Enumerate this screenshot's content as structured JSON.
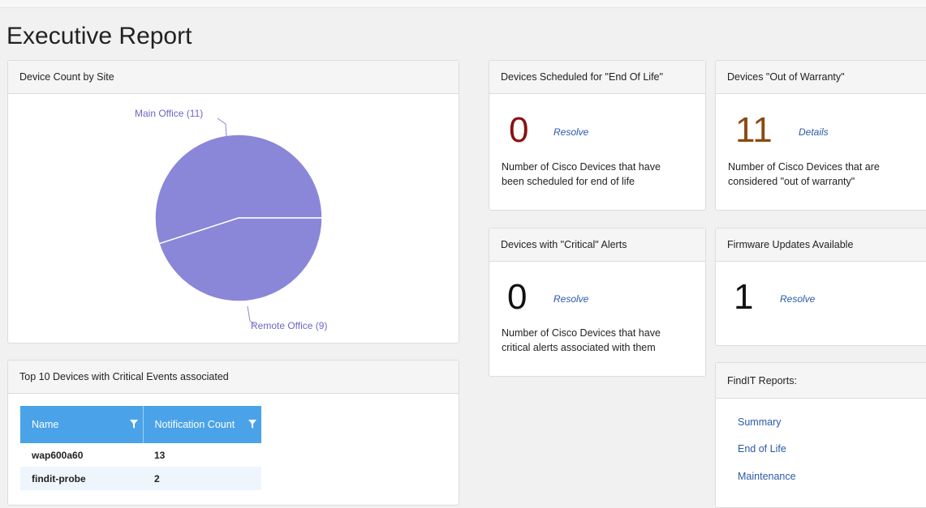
{
  "page_title": "Executive Report",
  "device_count": {
    "title": "Device Count by Site",
    "chart_data": {
      "type": "pie",
      "labels": [
        "Main Office (11)",
        "Remote Office (9)"
      ],
      "values": [
        11,
        9
      ],
      "colors": [
        "#8a86d8",
        "#8a86d8"
      ]
    }
  },
  "eol": {
    "title": "Devices Scheduled for \"End Of Life\"",
    "count": "0",
    "link": "Resolve",
    "description_line1": "Number of Cisco Devices that have",
    "description_line2": "been scheduled for end of life",
    "count_color": "#8b1010"
  },
  "warranty": {
    "title": "Devices \"Out of Warranty\"",
    "count": "11",
    "link": "Details",
    "description_line1": "Number of Cisco Devices that are",
    "description_line2": "considered \"out of warranty\"",
    "count_color": "#8a4b10"
  },
  "critical": {
    "title": "Devices with \"Critical\" Alerts",
    "count": "0",
    "link": "Resolve",
    "description_line1": "Number of Cisco Devices that have",
    "description_line2": "critical alerts associated with them"
  },
  "firmware": {
    "title": "Firmware Updates Available",
    "count": "1",
    "link": "Resolve"
  },
  "top10": {
    "title": "Top 10 Devices with Critical Events associated",
    "headers": [
      "Name",
      "Notification Count"
    ],
    "rows": [
      [
        "wap600a60",
        "13"
      ],
      [
        "findit-probe",
        "2"
      ]
    ]
  },
  "reports": {
    "title": "FindIT Reports:",
    "links": [
      "Summary",
      "End of Life",
      "Maintenance"
    ]
  },
  "colors": {
    "accent": "#4aa3e8",
    "link": "#2a5aa8",
    "pie": "#8a86d8"
  }
}
